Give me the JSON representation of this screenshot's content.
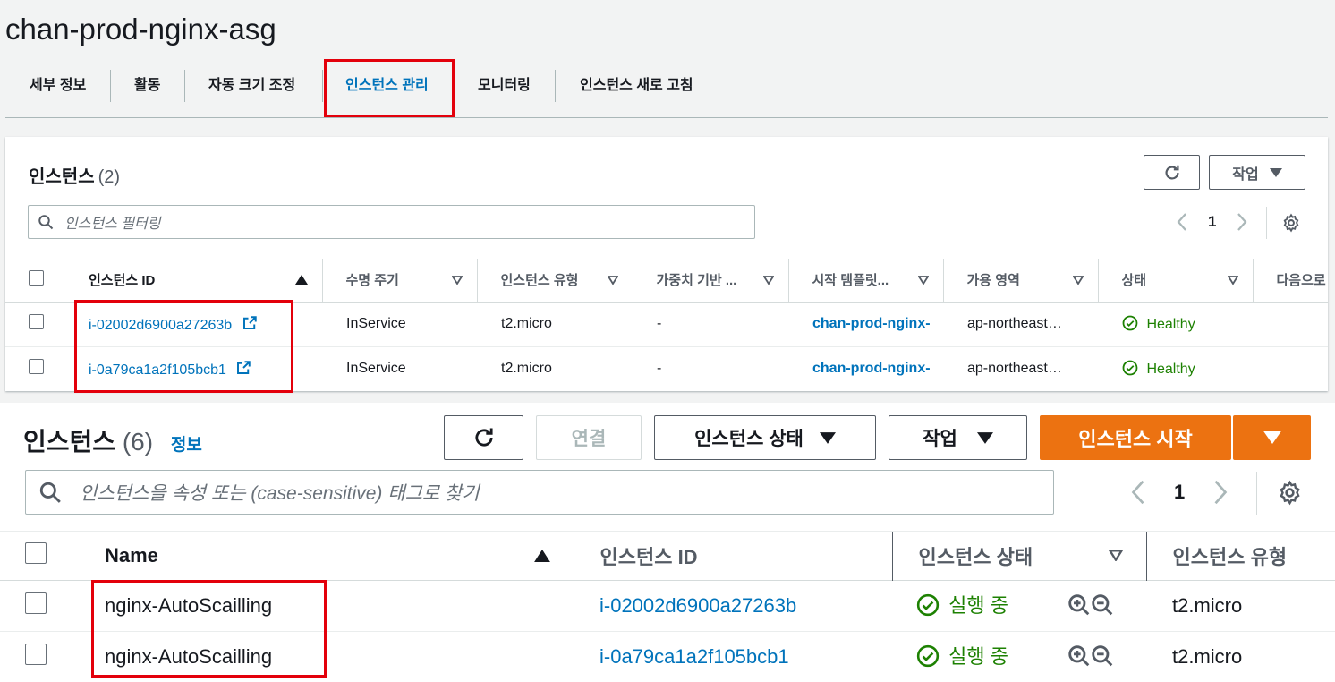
{
  "asg": {
    "title": "chan-prod-nginx-asg",
    "tabs": [
      {
        "label": "세부 정보"
      },
      {
        "label": "활동"
      },
      {
        "label": "자동 크기 조정"
      },
      {
        "label": "인스턴스 관리"
      },
      {
        "label": "모니터링"
      },
      {
        "label": "인스턴스 새로 고침"
      }
    ],
    "active_tab": "인스턴스 관리",
    "panel": {
      "title": "인스턴스",
      "count": "(2)",
      "actions_label": "작업",
      "filter_placeholder": "인스턴스 필터링",
      "page": "1",
      "columns": [
        "인스턴스 ID",
        "수명 주기",
        "인스턴스 유형",
        "가중치 기반 ...",
        "시작 템플릿...",
        "가용 영역",
        "상태",
        "다음으로"
      ],
      "rows": [
        {
          "instance_id": "i-02002d6900a27263b",
          "lifecycle": "InService",
          "type": "t2.micro",
          "weight": "-",
          "template": "chan-prod-nginx-",
          "az": "ap-northeast…",
          "status": "Healthy"
        },
        {
          "instance_id": "i-0a79ca1a2f105bcb1",
          "lifecycle": "InService",
          "type": "t2.micro",
          "weight": "-",
          "template": "chan-prod-nginx-",
          "az": "ap-northeast…",
          "status": "Healthy"
        }
      ]
    }
  },
  "ec2": {
    "title": "인스턴스",
    "count": "(6)",
    "info_link": "정보",
    "connect_label": "연결",
    "instance_state_label": "인스턴스 상태",
    "actions_label": "작업",
    "launch_label": "인스턴스 시작",
    "search_placeholder": "인스턴스을 속성 또는 (case-sensitive) 태그로 찾기",
    "page": "1",
    "columns": [
      "Name",
      "인스턴스 ID",
      "인스턴스 상태",
      "인스턴스 유형"
    ],
    "rows": [
      {
        "name": "nginx-AutoScailling",
        "instance_id": "i-02002d6900a27263b",
        "state": "실행 중",
        "type": "t2.micro"
      },
      {
        "name": "nginx-AutoScailling",
        "instance_id": "i-0a79ca1a2f105bcb1",
        "state": "실행 중",
        "type": "t2.micro"
      }
    ]
  },
  "colors": {
    "link": "#0073bb",
    "healthy": "#1d8102",
    "primary": "#ec7211",
    "highlight": "#e3000b"
  },
  "icons": [
    "refresh-icon",
    "caret-down-icon",
    "search-icon",
    "chevron-left-icon",
    "chevron-right-icon",
    "settings-gear-icon",
    "external-link-icon",
    "check-circle-icon",
    "zoom-in-icon",
    "zoom-out-icon",
    "sort-ascending-icon",
    "filter-caret-icon"
  ]
}
